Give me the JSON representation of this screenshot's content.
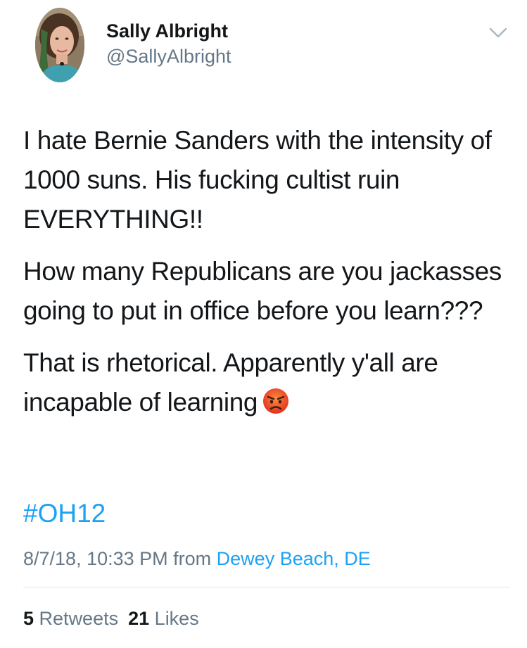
{
  "author": {
    "display_name": "Sally Albright",
    "handle": "@SallyAlbright",
    "avatar_icon": "profile-photo"
  },
  "menu_icon": "chevron-down-icon",
  "tweet": {
    "paragraphs": [
      "I hate Bernie Sanders with the intensity of 1000 suns. His fucking cultist ruin EVERYTHING!!",
      "How many Republicans are you jackasses going to put in office before you learn???",
      "That is rhetorical. Apparently y'all are incapable of learning"
    ],
    "emoji": "angry-face-emoji",
    "hashtag": "#OH12"
  },
  "meta": {
    "timestamp": "8/7/18, 10:33 PM",
    "from_label": "from",
    "location": "Dewey Beach, DE"
  },
  "stats": {
    "retweets_count": "5",
    "retweets_label": "Retweets",
    "likes_count": "21",
    "likes_label": "Likes"
  },
  "colors": {
    "link": "#1da1f2",
    "secondary_text": "#657786",
    "primary_text": "#14171a",
    "divider": "#e1e8ed"
  }
}
